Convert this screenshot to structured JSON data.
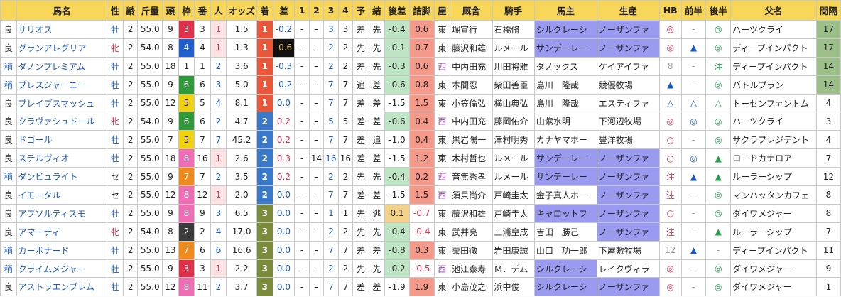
{
  "headers": [
    "",
    "馬名",
    "性",
    "齢",
    "斤量",
    "頭",
    "枠",
    "番",
    "人",
    "オッズ",
    "着",
    "差",
    "1",
    "2",
    "3",
    "4",
    "予",
    "結",
    "後差",
    "詰脚",
    "屋",
    "厩舎",
    "騎手",
    "馬主",
    "生産",
    "HB",
    "前半",
    "後半",
    "父名",
    "間隔"
  ],
  "colors": {
    "header_bg": "#f7d65a",
    "waku": {
      "1": "#ffffff",
      "2": "#3b3b3b",
      "3": "#e0304a",
      "4": "#1f5fd0",
      "5": "#f2d20a",
      "6": "#2f9a3a",
      "7": "#f08a1c",
      "8": "#f06cb4"
    },
    "place": {
      "1": "#e8573a",
      "2": "#3a79c9",
      "3": "#7a8b3c"
    },
    "owner_sunday": "#9a9af0",
    "breeder_nf": "#9a9af0",
    "interval_hi": "#9dc08b"
  },
  "rows": [
    {
      "cond": "良",
      "name": "サリオス",
      "sex": "牡",
      "age": "2",
      "weight": "55.0",
      "field": "9",
      "waku": "3",
      "ban": "3",
      "ninki": "1",
      "odds": "1.5",
      "chaku": "1",
      "diff": "-0.2",
      "c1": "-",
      "c2": "-",
      "c3": "3",
      "c4": "3",
      "yo": "差",
      "ke": "先",
      "atosa": "-0.4",
      "tsume": "0.6",
      "ya": "東",
      "trainer": "堀宣行",
      "jockey": "石橋脩",
      "owner": "シルクレーシ",
      "breeder": "ノーザンファ",
      "hb": "◎",
      "zen": "-",
      "kou": "◎",
      "sire": "ハーツクライ",
      "interval": "17",
      "owner_hl": true,
      "breeder_hl": true,
      "int_hl": true,
      "ninki_hl": true,
      "diff_dark": false,
      "atosa_hl": true,
      "tsume_hl": true
    },
    {
      "cond": "良",
      "name": "グランアレグリア",
      "sex": "牝",
      "age": "2",
      "weight": "54.0",
      "field": "8",
      "waku": "4",
      "ban": "4",
      "ninki": "1",
      "odds": "1.3",
      "chaku": "1",
      "diff": "-0.6",
      "c1": "-",
      "c2": "-",
      "c3": "2",
      "c4": "2",
      "yo": "先",
      "ke": "先",
      "atosa": "-0.1",
      "tsume": "0.7",
      "ya": "東",
      "trainer": "藤沢和雄",
      "jockey": "ルメール",
      "owner": "サンデーレー",
      "breeder": "ノーザンファ",
      "hb": "◎",
      "zen": "▲",
      "kou": "◎",
      "sire": "ディープインパクト",
      "interval": "17",
      "owner_hl": true,
      "breeder_hl": true,
      "int_hl": true,
      "ninki_hl": true,
      "diff_dark": true,
      "atosa_hl": true,
      "tsume_hl": true
    },
    {
      "cond": "稍",
      "name": "ダノンプレミアム",
      "sex": "牡",
      "age": "2",
      "weight": "55.0",
      "field": "18",
      "waku": "1",
      "ban": "1",
      "ninki": "2",
      "odds": "3.6",
      "chaku": "1",
      "diff": "-0.3",
      "c1": "-",
      "c2": "-",
      "c3": "2",
      "c4": "2",
      "yo": "差",
      "ke": "先",
      "atosa": "-0.3",
      "tsume": "0.6",
      "ya": "西",
      "trainer": "中内田充",
      "jockey": "川田将雅",
      "owner": "ダノックス",
      "breeder": "ケイアイファ",
      "hb": "8",
      "zen": "-",
      "kou": "注",
      "sire": "ディープインパクト",
      "interval": "14",
      "owner_hl": false,
      "breeder_hl": false,
      "int_hl": true,
      "ninki_hl": false,
      "diff_dark": false,
      "atosa_hl": true,
      "tsume_hl": true
    },
    {
      "cond": "稍",
      "name": "ブレスジャーニー",
      "sex": "牡",
      "age": "2",
      "weight": "55.0",
      "field": "9",
      "waku": "6",
      "ban": "6",
      "ninki": "3",
      "odds": "5.0",
      "chaku": "1",
      "diff": "-0.2",
      "c1": "-",
      "c2": "-",
      "c3": "7",
      "c4": "7",
      "yo": "追",
      "ke": "差",
      "atosa": "-0.6",
      "tsume": "0.8",
      "ya": "東",
      "trainer": "本間忍",
      "jockey": "柴田善臣",
      "owner": "島川　隆哉",
      "breeder": "競優牧場",
      "hb": "▲",
      "zen": "-",
      "kou": "◎",
      "sire": "バトルプラン",
      "interval": "14",
      "owner_hl": false,
      "breeder_hl": false,
      "int_hl": true,
      "ninki_hl": false,
      "diff_dark": false,
      "atosa_hl": true,
      "tsume_hl": true
    },
    {
      "cond": "良",
      "name": "ブレイブスマッシュ",
      "sex": "牡",
      "age": "2",
      "weight": "55.0",
      "field": "12",
      "waku": "5",
      "ban": "5",
      "ninki": "4",
      "odds": "8.1",
      "chaku": "1",
      "diff": "0.0",
      "c1": "-",
      "c2": "-",
      "c3": "7",
      "c4": "7",
      "yo": "差",
      "ke": "差",
      "atosa": "-1.5",
      "tsume": "1.5",
      "ya": "東",
      "trainer": "小笠倫弘",
      "jockey": "横山典弘",
      "owner": "島川　隆哉",
      "breeder": "エスティファ",
      "hb": "△",
      "zen": "△",
      "kou": "△",
      "sire": "トーセンファントム",
      "interval": "4",
      "owner_hl": false,
      "breeder_hl": false,
      "int_hl": false,
      "ninki_hl": false,
      "diff_dark": false,
      "atosa_hl": false,
      "tsume_hl": true
    },
    {
      "cond": "良",
      "name": "クラヴァシュドール",
      "sex": "牝",
      "age": "2",
      "weight": "54.0",
      "field": "9",
      "waku": "6",
      "ban": "6",
      "ninki": "2",
      "odds": "4.7",
      "chaku": "2",
      "diff": "0.2",
      "c1": "-",
      "c2": "-",
      "c3": "5",
      "c4": "5",
      "yo": "差",
      "ke": "差",
      "atosa": "-0.6",
      "tsume": "0.4",
      "ya": "西",
      "trainer": "中内田充",
      "jockey": "藤岡佑介",
      "owner": "山紫水明",
      "breeder": "下河辺牧場",
      "hb": "◎",
      "zen": "◎",
      "kou": "◎",
      "sire": "ハーツクライ",
      "interval": "3",
      "owner_hl": false,
      "breeder_hl": false,
      "int_hl": false,
      "ninki_hl": false,
      "diff_dark": false,
      "atosa_hl": true,
      "tsume_hl": true
    },
    {
      "cond": "良",
      "name": "ドゴール",
      "sex": "牡",
      "age": "2",
      "weight": "55.0",
      "field": "7",
      "waku": "5",
      "ban": "7",
      "ninki": "7",
      "odds": "45.2",
      "chaku": "2",
      "diff": "0.2",
      "c1": "-",
      "c2": "-",
      "c3": "7",
      "c4": "7",
      "yo": "差",
      "ke": "追",
      "atosa": "-1.0",
      "tsume": "0.4",
      "ya": "東",
      "trainer": "黒岩陽一",
      "jockey": "津村明秀",
      "owner": "カナヤマホー",
      "breeder": "豊洋牧場",
      "hb": "○",
      "zen": "-",
      "kou": "◎",
      "sire": "サクラプレジデント",
      "interval": "4",
      "owner_hl": false,
      "breeder_hl": false,
      "int_hl": false,
      "ninki_hl": false,
      "diff_dark": false,
      "atosa_hl": false,
      "tsume_hl": true
    },
    {
      "cond": "良",
      "name": "ステルヴィオ",
      "sex": "牡",
      "age": "2",
      "weight": "55.0",
      "field": "18",
      "waku": "8",
      "ban": "16",
      "ninki": "1",
      "odds": "2.6",
      "chaku": "2",
      "diff": "0.3",
      "c1": "-",
      "c2": "14",
      "c3": "16",
      "c4": "16",
      "yo": "差",
      "ke": "差",
      "atosa": "-1.5",
      "tsume": "1.2",
      "ya": "東",
      "trainer": "木村哲也",
      "jockey": "ルメール",
      "owner": "サンデーレー",
      "breeder": "ノーザンファ",
      "hb": "○",
      "zen": "◎",
      "kou": "▲",
      "sire": "ロードカナロア",
      "interval": "7",
      "owner_hl": true,
      "breeder_hl": true,
      "int_hl": false,
      "ninki_hl": true,
      "diff_dark": false,
      "atosa_hl": false,
      "tsume_hl": true
    },
    {
      "cond": "稍",
      "name": "ダンビュライト",
      "sex": "セ",
      "age": "2",
      "weight": "55.0",
      "field": "9",
      "waku": "7",
      "ban": "7",
      "ninki": "2",
      "odds": "3.5",
      "chaku": "2",
      "diff": "0.2",
      "c1": "-",
      "c2": "-",
      "c3": "2",
      "c4": "2",
      "yo": "先",
      "ke": "先",
      "atosa": "-0.4",
      "tsume": "0.2",
      "ya": "西",
      "trainer": "音無秀孝",
      "jockey": "ルメール",
      "owner": "サンデーレー",
      "breeder": "ノーザンファ",
      "hb": "注",
      "zen": "▲",
      "kou": "▲",
      "sire": "ルーラーシップ",
      "interval": "12",
      "owner_hl": true,
      "breeder_hl": true,
      "int_hl": false,
      "ninki_hl": false,
      "diff_dark": false,
      "atosa_hl": true,
      "tsume_hl": true
    },
    {
      "cond": "良",
      "name": "イモータル",
      "sex": "セ",
      "age": "2",
      "weight": "55.0",
      "field": "12",
      "waku": "8",
      "ban": "12",
      "ninki": "1",
      "odds": "2.0",
      "chaku": "2",
      "diff": "0.0",
      "c1": "-",
      "c2": "-",
      "c3": "7",
      "c4": "7",
      "yo": "差",
      "ke": "差",
      "atosa": "-1.5",
      "tsume": "1.5",
      "ya": "西",
      "trainer": "須貝尚介",
      "jockey": "戸崎圭太",
      "owner": "金子真人ホー",
      "breeder": "ノーザンファ",
      "hb": "注",
      "zen": "-",
      "kou": "◎",
      "sire": "マンハッタンカフェ",
      "interval": "8",
      "owner_hl": false,
      "breeder_hl": true,
      "int_hl": false,
      "ninki_hl": true,
      "diff_dark": false,
      "atosa_hl": false,
      "tsume_hl": true
    },
    {
      "cond": "良",
      "name": "アブソルティスモ",
      "sex": "牡",
      "age": "2",
      "weight": "55.0",
      "field": "9",
      "waku": "8",
      "ban": "9",
      "ninki": "3",
      "odds": "6.5",
      "chaku": "3",
      "diff": "0.0",
      "c1": "-",
      "c2": "-",
      "c3": "1",
      "c4": "1",
      "yo": "先",
      "ke": "逃",
      "atosa": "0.1",
      "tsume": "-0.7",
      "ya": "東",
      "trainer": "藤沢和雄",
      "jockey": "戸崎圭太",
      "owner": "キャロットフ",
      "breeder": "ノーザンファ",
      "hb": "○",
      "zen": "-",
      "kou": "◎",
      "sire": "ダイワメジャー",
      "interval": "8",
      "owner_hl": true,
      "breeder_hl": true,
      "int_hl": false,
      "ninki_hl": false,
      "diff_dark": false,
      "atosa_hl": true,
      "tsume_hl": false
    },
    {
      "cond": "良",
      "name": "アマーティ",
      "sex": "牝",
      "age": "2",
      "weight": "54.0",
      "field": "8",
      "waku": "2",
      "ban": "2",
      "ninki": "4",
      "odds": "17.0",
      "chaku": "3",
      "diff": "0.0",
      "c1": "-",
      "c2": "-",
      "c3": "2",
      "c4": "2",
      "yo": "先",
      "ke": "先",
      "atosa": "-0.4",
      "tsume": "-0.4",
      "ya": "東",
      "trainer": "武井亮",
      "jockey": "三浦皇成",
      "owner": "吉田　勝己",
      "breeder": "ノーザンファ",
      "hb": "注",
      "zen": "-",
      "kou": "▲",
      "sire": "ルーラーシップ",
      "interval": "7",
      "owner_hl": false,
      "breeder_hl": true,
      "int_hl": false,
      "ninki_hl": false,
      "diff_dark": false,
      "atosa_hl": true,
      "tsume_hl": false
    },
    {
      "cond": "稍",
      "name": "カーボナード",
      "sex": "牡",
      "age": "2",
      "weight": "55.0",
      "field": "13",
      "waku": "7",
      "ban": "6",
      "ninki": "6",
      "odds": "16.6",
      "chaku": "3",
      "diff": "0.0",
      "c1": "-",
      "c2": "-",
      "c3": "7",
      "c4": "7",
      "yo": "差",
      "ke": "差",
      "atosa": "-0.8",
      "tsume": "0.3",
      "ya": "東",
      "trainer": "栗田徹",
      "jockey": "岩田康誠",
      "owner": "山口　功一郎",
      "breeder": "下屋敷牧場",
      "hb": "12",
      "zen": "▲",
      "kou": "-",
      "sire": "ディープインパクト",
      "interval": "11",
      "owner_hl": false,
      "breeder_hl": false,
      "int_hl": false,
      "ninki_hl": false,
      "diff_dark": false,
      "atosa_hl": true,
      "tsume_hl": true
    },
    {
      "cond": "稍",
      "name": "クライムメジャー",
      "sex": "牡",
      "age": "2",
      "weight": "55.0",
      "field": "9",
      "waku": "3",
      "ban": "3",
      "ninki": "1",
      "odds": "2.2",
      "chaku": "3",
      "diff": "0.0",
      "c1": "-",
      "c2": "-",
      "c3": "2",
      "c4": "2",
      "yo": "先",
      "ke": "先",
      "atosa": "-0.2",
      "tsume": "-0.5",
      "ya": "西",
      "trainer": "池江泰寿",
      "jockey": "Ｍ．デム",
      "owner": "シルクレーシ",
      "breeder": "レイクヴィラ",
      "hb": "◎",
      "zen": "-",
      "kou": "◎",
      "sire": "ダイワメジャー",
      "interval": "9",
      "owner_hl": true,
      "breeder_hl": false,
      "int_hl": false,
      "ninki_hl": true,
      "diff_dark": false,
      "atosa_hl": true,
      "tsume_hl": false
    },
    {
      "cond": "良",
      "name": "アストラエンブレム",
      "sex": "牡",
      "age": "2",
      "weight": "55.0",
      "field": "12",
      "waku": "8",
      "ban": "11",
      "ninki": "2",
      "odds": "3.7",
      "chaku": "3",
      "diff": "0.0",
      "c1": "-",
      "c2": "-",
      "c3": "7",
      "c4": "7",
      "yo": "差",
      "ke": "差",
      "atosa": "-1.9",
      "tsume": "1.9",
      "ya": "東",
      "trainer": "小島茂之",
      "jockey": "浜中俊",
      "owner": "シルクレーシ",
      "breeder": "ノーザンファ",
      "hb": "◎",
      "zen": "-",
      "kou": "◎",
      "sire": "ダイワメジャー",
      "interval": "1",
      "owner_hl": true,
      "breeder_hl": true,
      "int_hl": false,
      "ninki_hl": false,
      "diff_dark": false,
      "atosa_hl": false,
      "tsume_hl": true
    }
  ]
}
